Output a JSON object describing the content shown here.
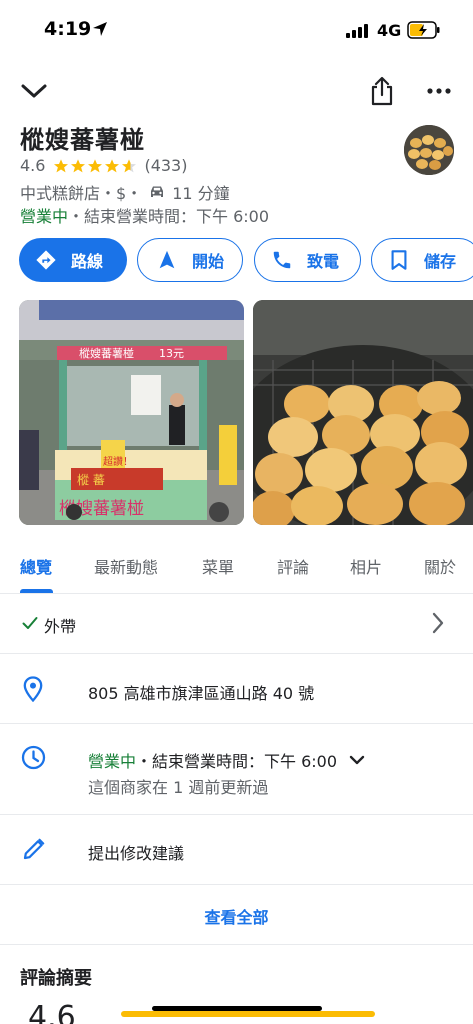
{
  "status": {
    "time": "4:19",
    "network": "4G"
  },
  "place": {
    "title": "樅嫂蕃薯椪",
    "rating": "4.6",
    "rating_value": 4.6,
    "review_count": "(433)",
    "category": "中式糕餅店・$・",
    "drive_time": "11 分鐘",
    "open_status": "營業中",
    "closing": "・結束營業時間：下午 6:00"
  },
  "actions": {
    "route": "路線",
    "start": "開始",
    "call": "致電",
    "save": "儲存"
  },
  "photos": {
    "stall_sign": "樅嫂蕃薯椪",
    "stall_price": "13元",
    "stall_board": "超讚！",
    "stall_red": "樅 蕃"
  },
  "tabs": [
    "總覽",
    "最新動態",
    "菜單",
    "評論",
    "相片",
    "關於"
  ],
  "takeout": {
    "label": "外帶"
  },
  "address": {
    "text": "805 高雄市旗津區通山路 40 號"
  },
  "hours": {
    "open": "營業中",
    "closing": "・結束營業時間：下午 6:00",
    "updated": "這個商家在 1 週前更新過"
  },
  "suggest": {
    "label": "提出修改建議"
  },
  "see_all": {
    "label": "查看全部"
  },
  "reviews": {
    "heading": "評論摘要",
    "score": "4.6"
  },
  "colors": {
    "accent": "#1a73e8",
    "open": "#188038",
    "star": "#fbbc04"
  },
  "icons": [
    "location-arrow-icon",
    "signal-icon",
    "battery-icon",
    "chevron-down-icon",
    "share-icon",
    "more-icon",
    "star-icon",
    "car-icon",
    "directions-icon",
    "navigation-icon",
    "phone-icon",
    "bookmark-icon",
    "check-icon",
    "chevron-right-icon",
    "pin-icon",
    "clock-icon",
    "pencil-icon"
  ]
}
